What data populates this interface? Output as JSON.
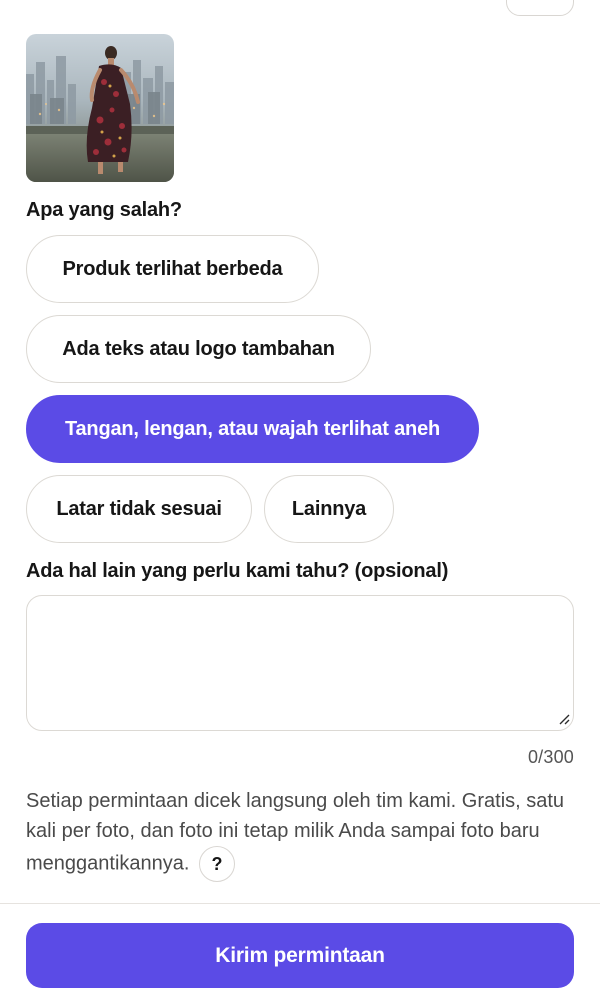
{
  "photo": {
    "alt": "Foto produk: wanita bergaun motif bunga berjalan di atap dengan latar kota"
  },
  "question1": {
    "label": "Apa yang salah?",
    "options": [
      {
        "label": "Produk terlihat berbeda",
        "selected": false
      },
      {
        "label": "Ada teks atau logo tambahan",
        "selected": false
      },
      {
        "label": "Tangan, lengan, atau wajah terlihat aneh",
        "selected": true
      },
      {
        "label": "Latar tidak sesuai",
        "selected": false
      },
      {
        "label": "Lainnya",
        "selected": false
      }
    ]
  },
  "question2": {
    "label": "Ada hal lain yang perlu kami tahu? (opsional)",
    "value": "",
    "placeholder": "",
    "counter": "0/300"
  },
  "info": {
    "text": "Setiap permintaan dicek langsung oleh tim kami. Gratis, satu kali per foto, dan foto ini tetap milik Anda sampai foto baru menggantikannya.",
    "help_label": "?"
  },
  "submit": {
    "label": "Kirim permintaan"
  },
  "colors": {
    "accent": "#5b4be6",
    "border": "#dcd9d4",
    "text": "#161616",
    "muted": "#4a4a4a"
  }
}
